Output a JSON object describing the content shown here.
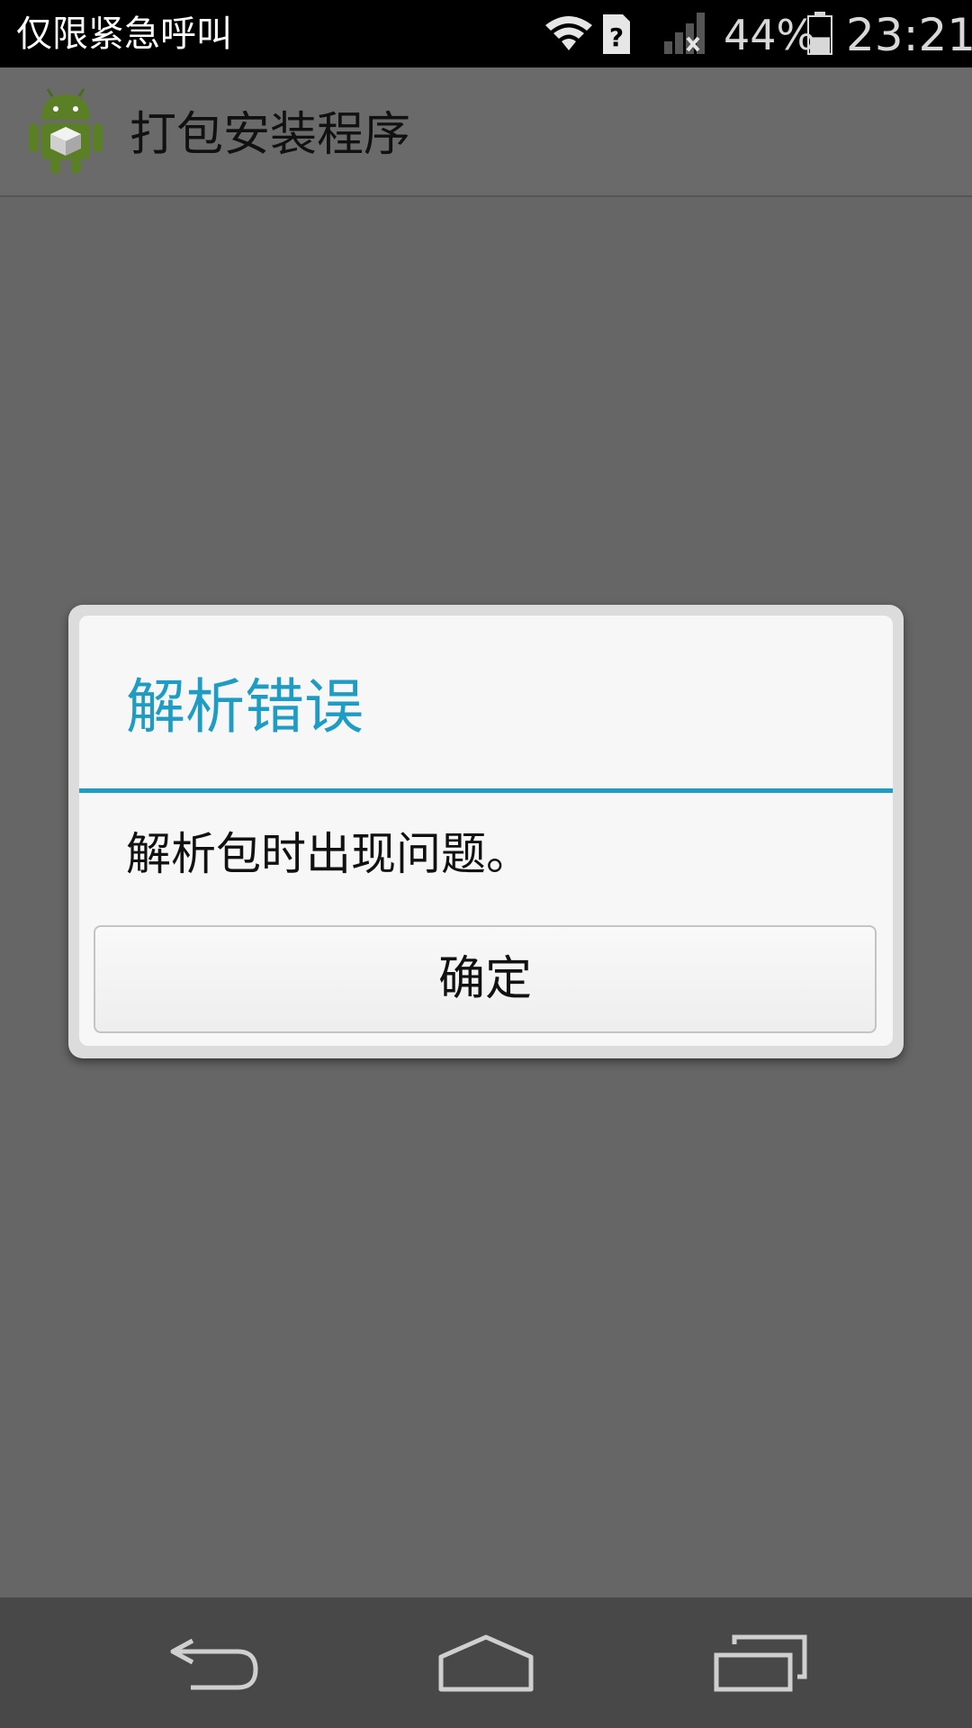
{
  "status_bar": {
    "carrier_text": "仅限紧急呼叫",
    "battery_percent": "44%",
    "battery_level": 0.44,
    "time": "23:21",
    "icons": [
      "wifi-icon",
      "sim-unknown-icon",
      "signal-no-service-icon",
      "battery-icon"
    ]
  },
  "action_bar": {
    "app_icon": "android-package-icon",
    "title": "打包安装程序"
  },
  "dialog": {
    "title": "解析错误",
    "message": "解析包时出现问题。",
    "ok_label": "确定",
    "accent_color": "#1e9cc4"
  },
  "nav_bar": {
    "icons": [
      "back-icon",
      "home-icon",
      "recent-apps-icon"
    ]
  }
}
